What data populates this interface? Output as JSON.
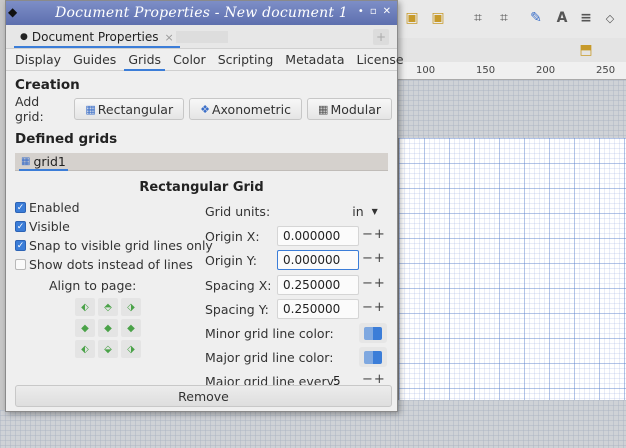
{
  "window": {
    "title": "Document Properties - New document 1",
    "buttons": [
      "•",
      "▫",
      "✕"
    ]
  },
  "panel": {
    "tab_label": "Document Properties",
    "tab_close": "×"
  },
  "tabs": [
    "Display",
    "Guides",
    "Grids",
    "Color",
    "Scripting",
    "Metadata",
    "License"
  ],
  "active_tab": "Grids",
  "creation": {
    "title": "Creation",
    "add_grid_label": "Add grid:",
    "buttons": {
      "rectangular": "Rectangular",
      "axonometric": "Axonometric",
      "modular": "Modular"
    }
  },
  "defined": {
    "title": "Defined grids",
    "grid_tab": "grid1"
  },
  "rect_grid": {
    "title": "Rectangular Grid",
    "checkboxes": {
      "enabled": {
        "label": "Enabled",
        "checked": true
      },
      "visible": {
        "label": "Visible",
        "checked": true
      },
      "snap": {
        "label": "Snap to visible grid lines only",
        "checked": true
      },
      "dots": {
        "label": "Show dots instead of lines",
        "checked": false
      }
    },
    "align_label": "Align to page:",
    "fields": {
      "units_label": "Grid units:",
      "units_value": "in",
      "origin_x_label": "Origin X:",
      "origin_x": "0.000000",
      "origin_y_label": "Origin Y:",
      "origin_y": "0.000000",
      "spacing_x_label": "Spacing X:",
      "spacing_x": "0.250000",
      "spacing_y_label": "Spacing Y:",
      "spacing_y": "0.250000",
      "minor_color_label": "Minor grid line color:",
      "major_color_label": "Major grid line color:",
      "major_every_label": "Major grid line every:",
      "major_every": "5"
    },
    "stepper": "−+",
    "remove_label": "Remove"
  },
  "ruler": {
    "labels": [
      "100",
      "150",
      "200",
      "250"
    ]
  },
  "colors": {
    "accent": "#3b7dd8",
    "title_bar": "#6a7bbd",
    "align_icon": "#4aa248"
  }
}
